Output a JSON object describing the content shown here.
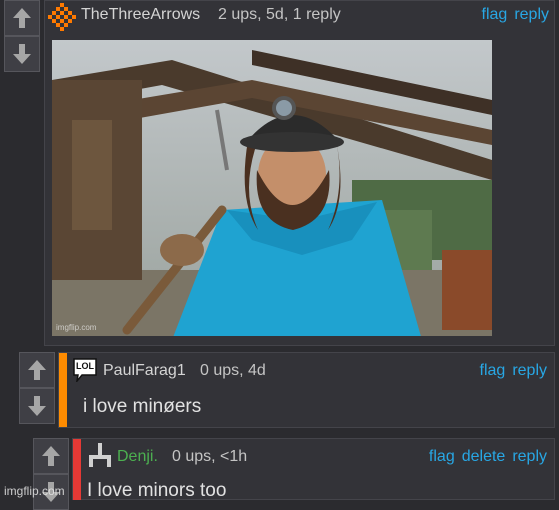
{
  "comments": [
    {
      "username": "TheThreeArrows",
      "meta": "2 ups, 5d, 1 reply",
      "actions": [
        "flag",
        "reply"
      ],
      "bar_color": "#ff8c00",
      "image_watermark": "imgflip.com"
    },
    {
      "username": "PaulFarag1",
      "meta": "0 ups, 4d",
      "actions": [
        "flag",
        "reply"
      ],
      "text": "i love minøers",
      "avatar_text": "LOL",
      "bar_color": "#ff8c00"
    },
    {
      "username": "Denji.",
      "meta": "0 ups, <1h",
      "actions": [
        "flag",
        "delete",
        "reply"
      ],
      "text": "I love minors too",
      "bar_color": "#e53935",
      "username_color": "#4caf50"
    }
  ],
  "page_watermark": "imgflip.com",
  "colors": {
    "link": "#28a7e4",
    "background": "#2b2b2f",
    "panel": "#333338"
  }
}
